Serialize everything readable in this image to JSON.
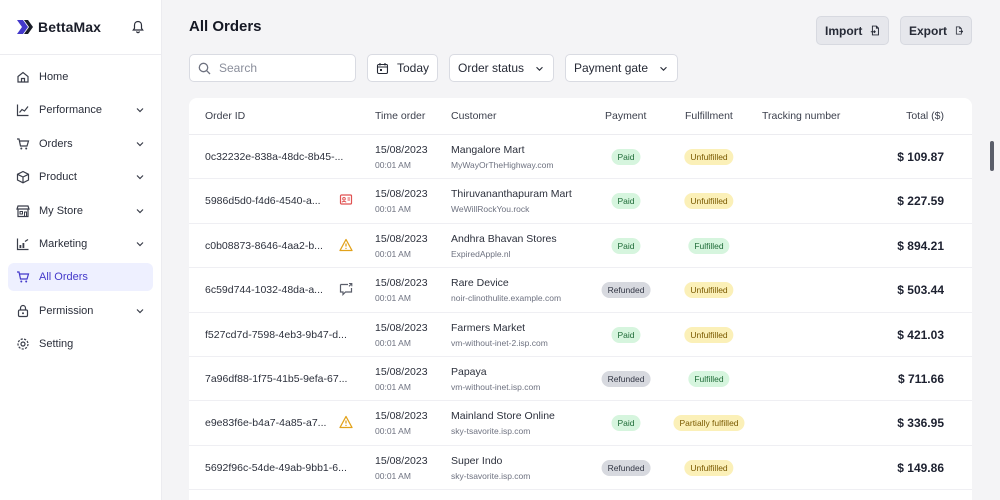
{
  "brand": {
    "name": "BettaMax",
    "logo_icon": "logo-icon",
    "bell_icon": "bell-icon"
  },
  "nav": [
    {
      "label": "Home",
      "icon": "home-icon",
      "chevron": false,
      "active": false
    },
    {
      "label": "Performance",
      "icon": "chart-icon",
      "chevron": true,
      "active": false
    },
    {
      "label": "Orders",
      "icon": "cart-icon",
      "chevron": true,
      "active": false
    },
    {
      "label": "Product",
      "icon": "box-icon",
      "chevron": true,
      "active": false
    },
    {
      "label": "My Store",
      "icon": "store-icon",
      "chevron": true,
      "active": false
    },
    {
      "label": "Marketing",
      "icon": "marketing-icon",
      "chevron": true,
      "active": false
    },
    {
      "label": "All Orders",
      "icon": "cart-icon",
      "chevron": false,
      "active": true
    },
    {
      "label": "Permission",
      "icon": "lock-icon",
      "chevron": true,
      "active": false
    },
    {
      "label": "Setting",
      "icon": "gear-icon",
      "chevron": false,
      "active": false
    }
  ],
  "page": {
    "title": "All Orders"
  },
  "actions": {
    "import_label": "Import",
    "export_label": "Export"
  },
  "filters": {
    "search_placeholder": "Search",
    "date_label": "Today",
    "status_label": "Order status",
    "gate_label": "Payment gate"
  },
  "table": {
    "headers": {
      "order_id": "Order ID",
      "time": "Time order",
      "customer": "Customer",
      "payment": "Payment",
      "fulfillment": "Fulfillment",
      "tracking": "Tracking number",
      "total": "Total ($)"
    },
    "rows": [
      {
        "id": "0c32232e-838a-48dc-8b45-...",
        "flag": "",
        "date": "15/08/2023",
        "time": "00:01 AM",
        "customer": "Mangalore Mart",
        "site": "MyWayOrTheHighway.com",
        "payment": "Paid",
        "payment_kind": "paid",
        "fulfillment": "Unfulfilled",
        "fulfillment_kind": "unfulfilled",
        "total": "$ 109.87"
      },
      {
        "id": "5986d5d0-f4d6-4540-a...",
        "flag": "contact-icon",
        "date": "15/08/2023",
        "time": "00:01 AM",
        "customer": "Thiruvananthapuram Mart",
        "site": "WeWillRockYou.rock",
        "payment": "Paid",
        "payment_kind": "paid",
        "fulfillment": "Unfulfilled",
        "fulfillment_kind": "unfulfilled",
        "total": "$ 227.59"
      },
      {
        "id": "c0b08873-8646-4aa2-b...",
        "flag": "warning-icon",
        "date": "15/08/2023",
        "time": "00:01 AM",
        "customer": "Andhra Bhavan Stores",
        "site": "ExpiredApple.nl",
        "payment": "Paid",
        "payment_kind": "paid",
        "fulfillment": "Fulfilled",
        "fulfillment_kind": "fulfilled",
        "total": "$ 894.21"
      },
      {
        "id": "6c59d744-1032-48da-a...",
        "flag": "message-icon",
        "date": "15/08/2023",
        "time": "00:01 AM",
        "customer": "Rare Device",
        "site": "noir-clinothulite.example.com",
        "payment": "Refunded",
        "payment_kind": "refunded",
        "fulfillment": "Unfulfilled",
        "fulfillment_kind": "unfulfilled",
        "total": "$ 503.44"
      },
      {
        "id": "f527cd7d-7598-4eb3-9b47-d...",
        "flag": "",
        "date": "15/08/2023",
        "time": "00:01 AM",
        "customer": "Farmers Market",
        "site": "vm-without-inet-2.isp.com",
        "payment": "Paid",
        "payment_kind": "paid",
        "fulfillment": "Unfulfilled",
        "fulfillment_kind": "unfulfilled",
        "total": "$ 421.03"
      },
      {
        "id": "7a96df88-1f75-41b5-9efa-67...",
        "flag": "",
        "date": "15/08/2023",
        "time": "00:01 AM",
        "customer": "Papaya",
        "site": "vm-without-inet.isp.com",
        "payment": "Refunded",
        "payment_kind": "refunded",
        "fulfillment": "Fulfilled",
        "fulfillment_kind": "fulfilled",
        "total": "$ 711.66"
      },
      {
        "id": "e9e83f6e-b4a7-4a85-a7...",
        "flag": "warning-icon",
        "date": "15/08/2023",
        "time": "00:01 AM",
        "customer": "Mainland Store Online",
        "site": "sky-tsavorite.isp.com",
        "payment": "Paid",
        "payment_kind": "paid",
        "fulfillment": "Partially fulfilled",
        "fulfillment_kind": "partial",
        "total": "$ 336.95"
      },
      {
        "id": "5692f96c-54de-49ab-9bb1-6...",
        "flag": "",
        "date": "15/08/2023",
        "time": "00:01 AM",
        "customer": "Super Indo",
        "site": "sky-tsavorite.isp.com",
        "payment": "Refunded",
        "payment_kind": "refunded",
        "fulfillment": "Unfulfilled",
        "fulfillment_kind": "unfulfilled",
        "total": "$ 149.86"
      }
    ]
  },
  "colors": {
    "accent": "#4338ca",
    "active_bg": "#eef0ff",
    "warning": "#e2a21b",
    "flag_red": "#e05252"
  }
}
